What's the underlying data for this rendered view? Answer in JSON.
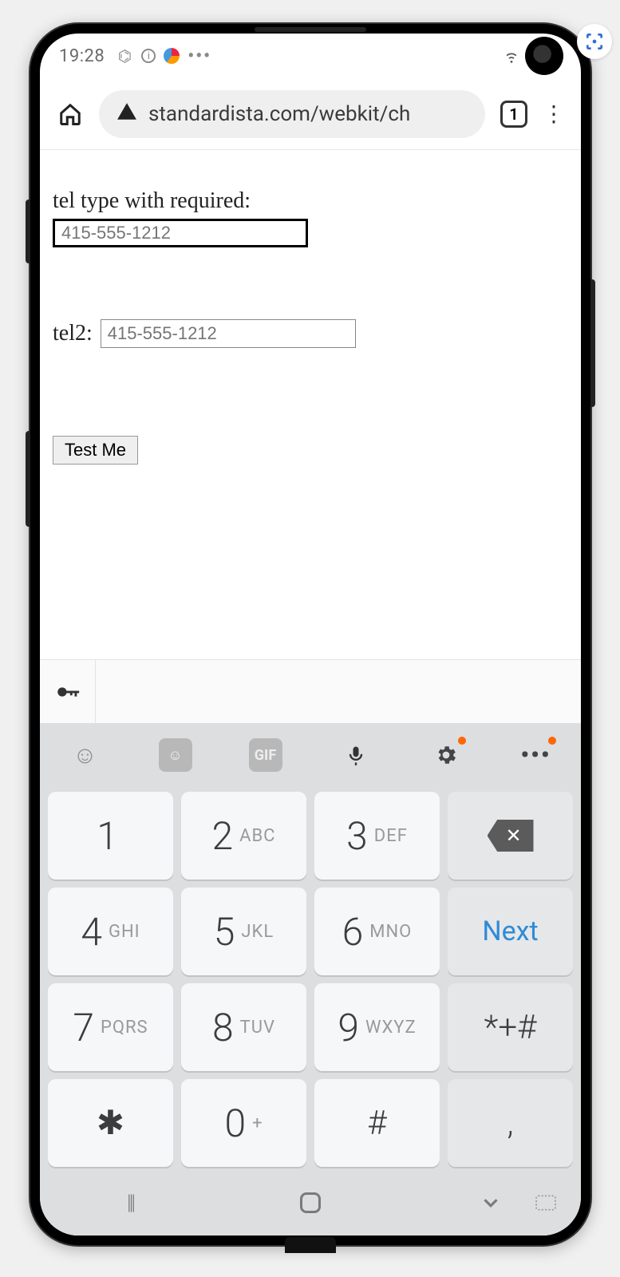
{
  "status": {
    "time": "19:28",
    "tab_count": "1"
  },
  "toolbar": {
    "url": "standardista.com/webkit/ch"
  },
  "page": {
    "label1": "tel type with required:",
    "input1_placeholder": "415-555-1212",
    "label2": "tel2:",
    "input2_placeholder": "415-555-1212",
    "button": "Test Me"
  },
  "keyboard": {
    "gif": "GIF",
    "next": "Next",
    "keys": [
      {
        "n": "1",
        "s": ""
      },
      {
        "n": "2",
        "s": "ABC"
      },
      {
        "n": "3",
        "s": "DEF"
      },
      {
        "n": "4",
        "s": "GHI"
      },
      {
        "n": "5",
        "s": "JKL"
      },
      {
        "n": "6",
        "s": "MNO"
      },
      {
        "n": "7",
        "s": "PQRS"
      },
      {
        "n": "8",
        "s": "TUV"
      },
      {
        "n": "9",
        "s": "WXYZ"
      },
      {
        "n": "✱",
        "s": ""
      },
      {
        "n": "0",
        "s": "+"
      },
      {
        "n": "#",
        "s": ""
      }
    ],
    "sym": "*+#",
    "comma": ","
  }
}
